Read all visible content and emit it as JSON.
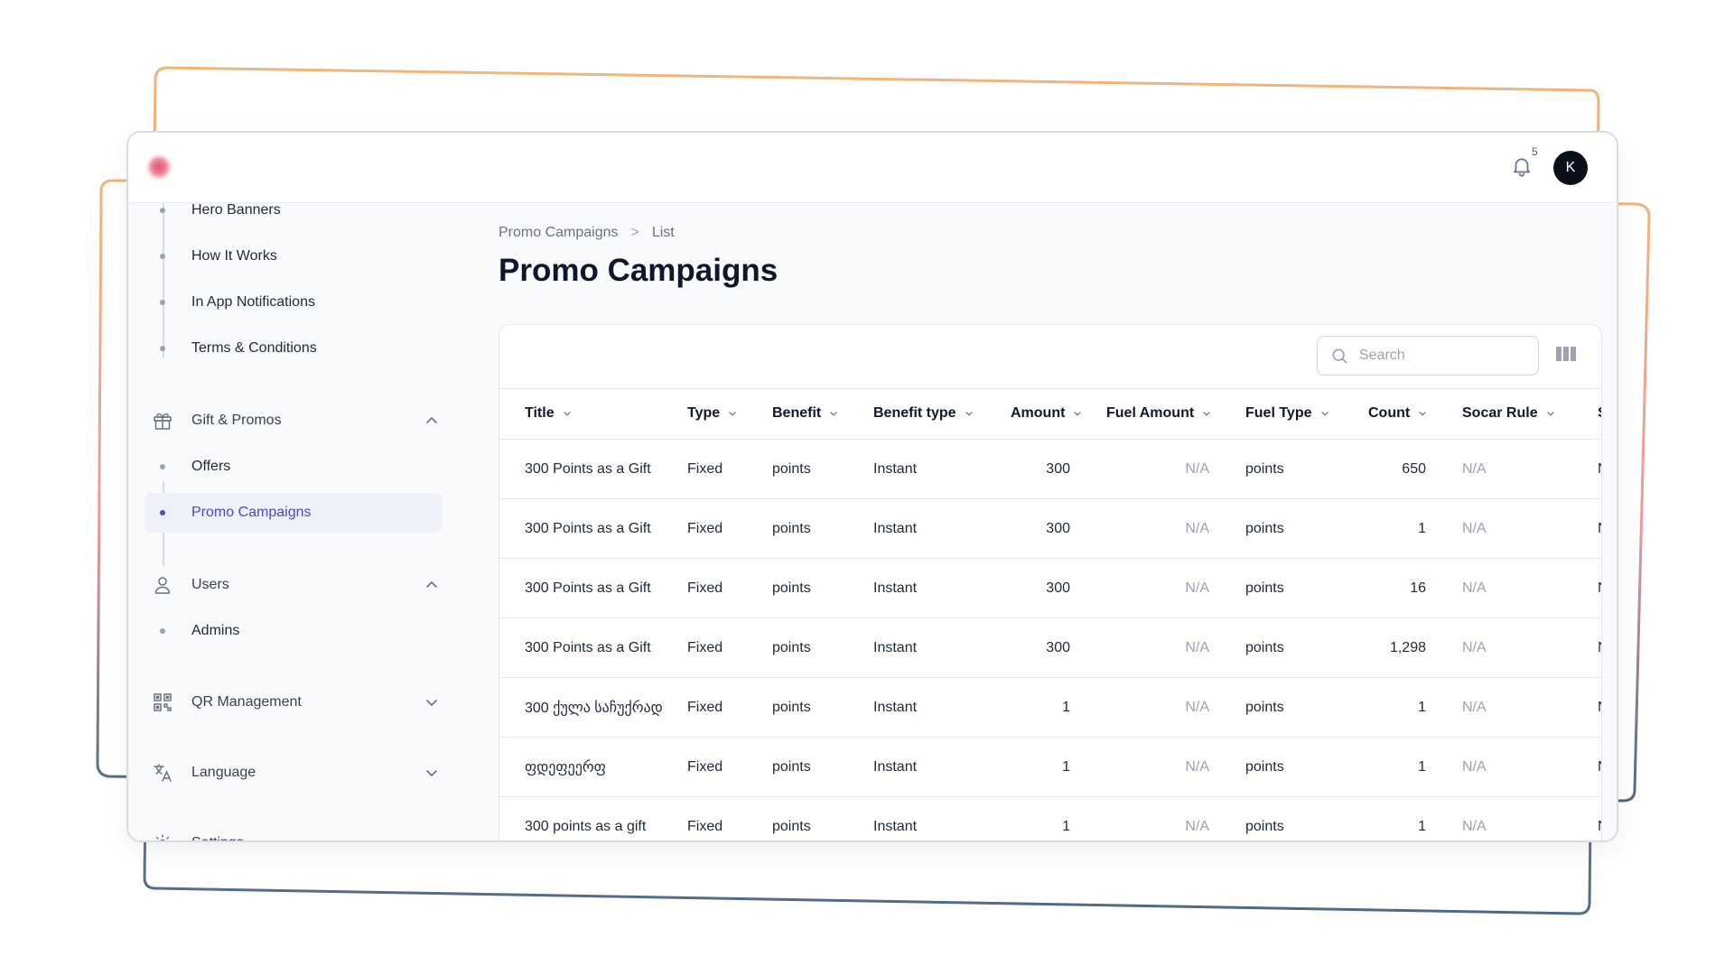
{
  "header": {
    "notification_count": "5",
    "avatar_initial": "K"
  },
  "sidebar": {
    "content_items": [
      {
        "label": "Hero Banners"
      },
      {
        "label": "How It Works"
      },
      {
        "label": "In App Notifications"
      },
      {
        "label": "Terms & Conditions"
      }
    ],
    "groups": [
      {
        "label": "Gift & Promos",
        "expanded": true,
        "icon": "gift-icon",
        "items": [
          {
            "label": "Offers"
          },
          {
            "label": "Promo Campaigns",
            "active": true
          }
        ]
      },
      {
        "label": "Users",
        "expanded": true,
        "icon": "user-icon",
        "items": [
          {
            "label": "Admins"
          }
        ]
      },
      {
        "label": "QR Management",
        "expanded": false,
        "icon": "qr-icon"
      },
      {
        "label": "Language",
        "expanded": false,
        "icon": "translate-icon"
      },
      {
        "label": "Settings",
        "expanded": false,
        "icon": "gear-icon"
      }
    ]
  },
  "breadcrumb": {
    "parent": "Promo Campaigns",
    "separator": ">",
    "current": "List"
  },
  "page": {
    "title": "Promo Campaigns"
  },
  "search": {
    "placeholder": "Search",
    "value": ""
  },
  "table": {
    "columns": [
      "Title",
      "Type",
      "Benefit",
      "Benefit type",
      "Amount",
      "Fuel Amount",
      "Fuel Type",
      "Count",
      "Socar Rule",
      "S"
    ],
    "rows": [
      [
        "300 Points as a Gift",
        "Fixed",
        "points",
        "Instant",
        "300",
        "N/A",
        "points",
        "650",
        "N/A",
        "N"
      ],
      [
        "300 Points as a Gift",
        "Fixed",
        "points",
        "Instant",
        "300",
        "N/A",
        "points",
        "1",
        "N/A",
        "N"
      ],
      [
        "300 Points as a Gift",
        "Fixed",
        "points",
        "Instant",
        "300",
        "N/A",
        "points",
        "16",
        "N/A",
        "N"
      ],
      [
        "300 Points as a Gift",
        "Fixed",
        "points",
        "Instant",
        "300",
        "N/A",
        "points",
        "1,298",
        "N/A",
        "N"
      ],
      [
        "300 ქულა საჩუქრად",
        "Fixed",
        "points",
        "Instant",
        "1",
        "N/A",
        "points",
        "1",
        "N/A",
        "N"
      ],
      [
        "ფდეფეერფ",
        "Fixed",
        "points",
        "Instant",
        "1",
        "N/A",
        "points",
        "1",
        "N/A",
        "N"
      ],
      [
        "300 points as a gift",
        "Fixed",
        "points",
        "Instant",
        "1",
        "N/A",
        "points",
        "1",
        "N/A",
        "N"
      ]
    ]
  },
  "colors": {
    "accent": "#4f46c8",
    "frame_orange": "#f0b679",
    "frame_slate": "#4d6b84",
    "frame_pink": "#ec9aa2"
  }
}
